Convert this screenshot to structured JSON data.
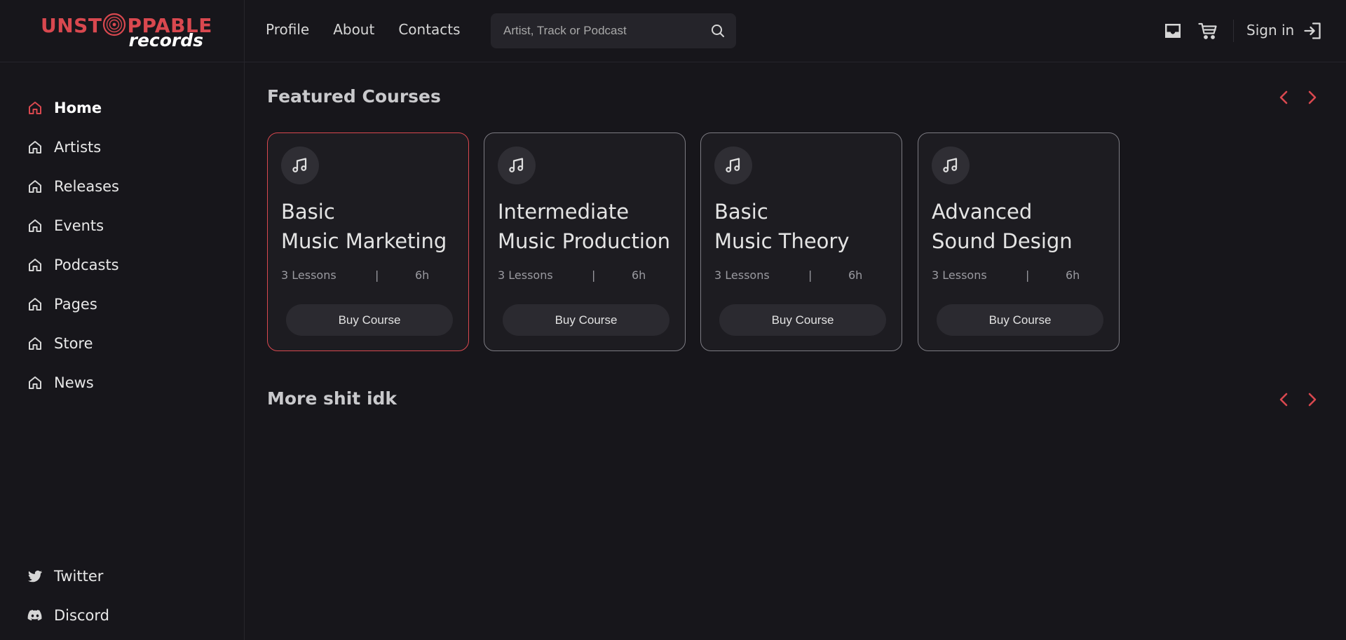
{
  "brand": {
    "line1": "UNST",
    "line1_tail": "PPABLE",
    "line2": "records",
    "accent_color": "#d9484f"
  },
  "sidebar": {
    "items": [
      {
        "label": "Home",
        "icon": "home-icon",
        "active": true
      },
      {
        "label": "Artists",
        "icon": "home-icon",
        "active": false
      },
      {
        "label": "Releases",
        "icon": "home-icon",
        "active": false
      },
      {
        "label": "Events",
        "icon": "home-icon",
        "active": false
      },
      {
        "label": "Podcasts",
        "icon": "home-icon",
        "active": false
      },
      {
        "label": "Pages",
        "icon": "home-icon",
        "active": false
      },
      {
        "label": "Store",
        "icon": "home-icon",
        "active": false
      },
      {
        "label": "News",
        "icon": "home-icon",
        "active": false
      }
    ],
    "social": [
      {
        "label": "Twitter",
        "icon": "twitter-icon"
      },
      {
        "label": "Discord",
        "icon": "discord-icon"
      }
    ]
  },
  "header": {
    "nav": [
      {
        "label": "Profile"
      },
      {
        "label": "About"
      },
      {
        "label": "Contacts"
      }
    ],
    "search": {
      "placeholder": "Artist, Track or Podcast",
      "icon": "search-icon"
    },
    "inbox_icon": "inbox-icon",
    "cart_icon": "cart-icon",
    "signin_label": "Sign in",
    "signin_icon": "sign-in-icon"
  },
  "main": {
    "featured_title": "Featured Courses",
    "courses": [
      {
        "title1": "Basic",
        "title2": "Music Marketing",
        "lessons": "3 Lessons",
        "divider": "|",
        "duration": "6h",
        "button": "Buy Course",
        "selected": true
      },
      {
        "title1": "Intermediate",
        "title2": "Music Production",
        "lessons": "3 Lessons",
        "divider": "|",
        "duration": "6h",
        "button": "Buy Course",
        "selected": false
      },
      {
        "title1": "Basic",
        "title2": "Music Theory",
        "lessons": "3 Lessons",
        "divider": "|",
        "duration": "6h",
        "button": "Buy Course",
        "selected": false
      },
      {
        "title1": "Advanced",
        "title2": "Sound Design",
        "lessons": "3 Lessons",
        "divider": "|",
        "duration": "6h",
        "button": "Buy Course",
        "selected": false
      }
    ],
    "more_title": "More shit idk"
  }
}
